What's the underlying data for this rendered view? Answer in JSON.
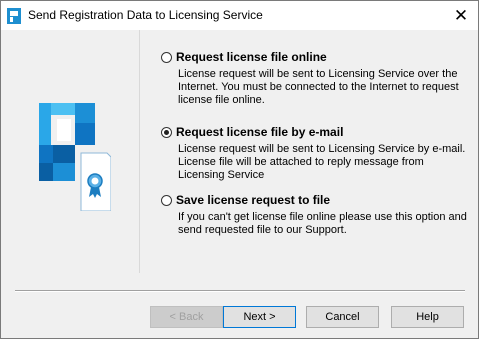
{
  "window": {
    "title": "Send Registration Data to Licensing Service",
    "close_label": "✕"
  },
  "options": [
    {
      "label": "Request license file online",
      "description": "License request will be sent to Licensing Service over the Internet. You must be connected to the Internet to request license file online.",
      "checked": false
    },
    {
      "label": "Request license file by e-mail",
      "description": "License request will be sent to Licensing Service by e-mail. License file will be attached to reply message from Licensing Service",
      "checked": true
    },
    {
      "label": "Save license request to file",
      "description": "If you can't get license file online please use this option and send requested file to our Support.",
      "checked": false
    }
  ],
  "buttons": {
    "back": "< Back",
    "next": "Next >",
    "cancel": "Cancel",
    "help": "Help"
  },
  "colors": {
    "accent": "#0078d7",
    "logo_blue": "#1e8fd0",
    "logo_dark": "#0a5fa3"
  }
}
